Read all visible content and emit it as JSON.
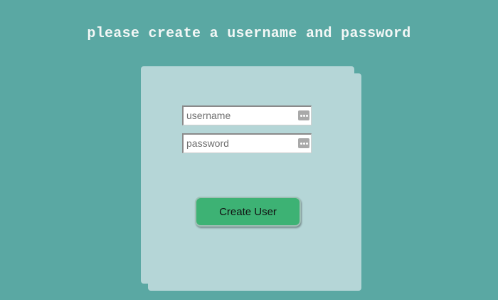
{
  "heading": "please create a username and password",
  "form": {
    "username": {
      "placeholder": "username",
      "value": "",
      "icon": "password-manager-icon"
    },
    "password": {
      "placeholder": "password",
      "value": "",
      "icon": "password-manager-icon"
    },
    "submit_label": "Create User"
  },
  "colors": {
    "background": "#5aa8a3",
    "card": "#b5d6d7",
    "button": "#3db274",
    "heading": "#f3f7f6"
  }
}
